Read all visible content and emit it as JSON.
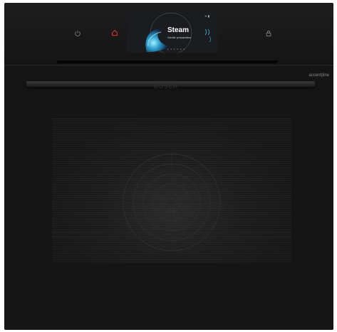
{
  "display": {
    "title": "Steam",
    "subtitle": "Gentle preparation",
    "dots": "• • • • • •",
    "status_icons": "ᯤ ▮"
  },
  "door": {
    "brand": "BOSCH",
    "accent_line": "accent|line"
  },
  "icons": {
    "power": "power-icon",
    "home": "home-icon",
    "lock": "lock-icon",
    "fan": "fan-icon"
  },
  "colors": {
    "body": "#141414",
    "home_accent": "#d0342c",
    "display_accent": "#3db8d8"
  }
}
